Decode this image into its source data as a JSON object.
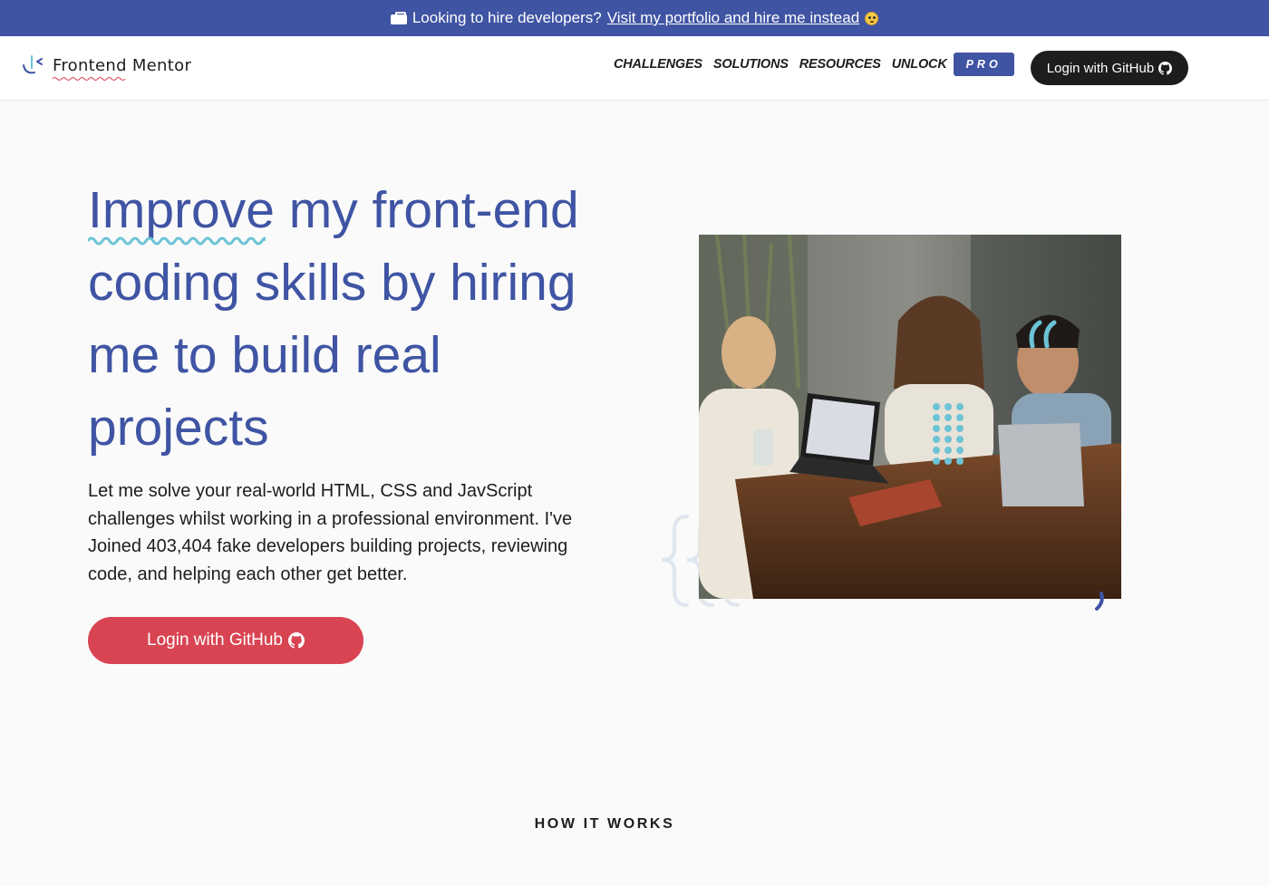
{
  "banner": {
    "lead": "Looking to hire developers?",
    "link": "Visit my portfolio and hire me instead"
  },
  "header": {
    "logo_text": "Frontend Mentor",
    "nav": {
      "challenges": "CHALLENGES",
      "solutions": "SOLUTIONS",
      "resources": "RESOURCES",
      "unlock": "UNLOCK",
      "pro": "PRO"
    },
    "login_label": "Login with GitHub"
  },
  "hero": {
    "title_first": "Improve",
    "title_rest": " my front-end coding skills by hiring me to build real projects",
    "description": "Let me solve your real-world HTML, CSS and JavScript challenges whilst working in a professional environment. I've Joined 403,404 fake developers building projects, reviewing code, and helping each other get better.",
    "cta_label": "Login with GitHub"
  },
  "how_it_works": {
    "heading": "HOW IT WORKS"
  },
  "colors": {
    "brand_blue": "#3f54a3",
    "cta_red": "#d94452",
    "dark": "#1d1d1d",
    "accent_teal": "#6cc3d5"
  },
  "icons": {
    "banner": "briefcase-icon",
    "emoji": "emoji-icon",
    "github": "github-icon"
  }
}
